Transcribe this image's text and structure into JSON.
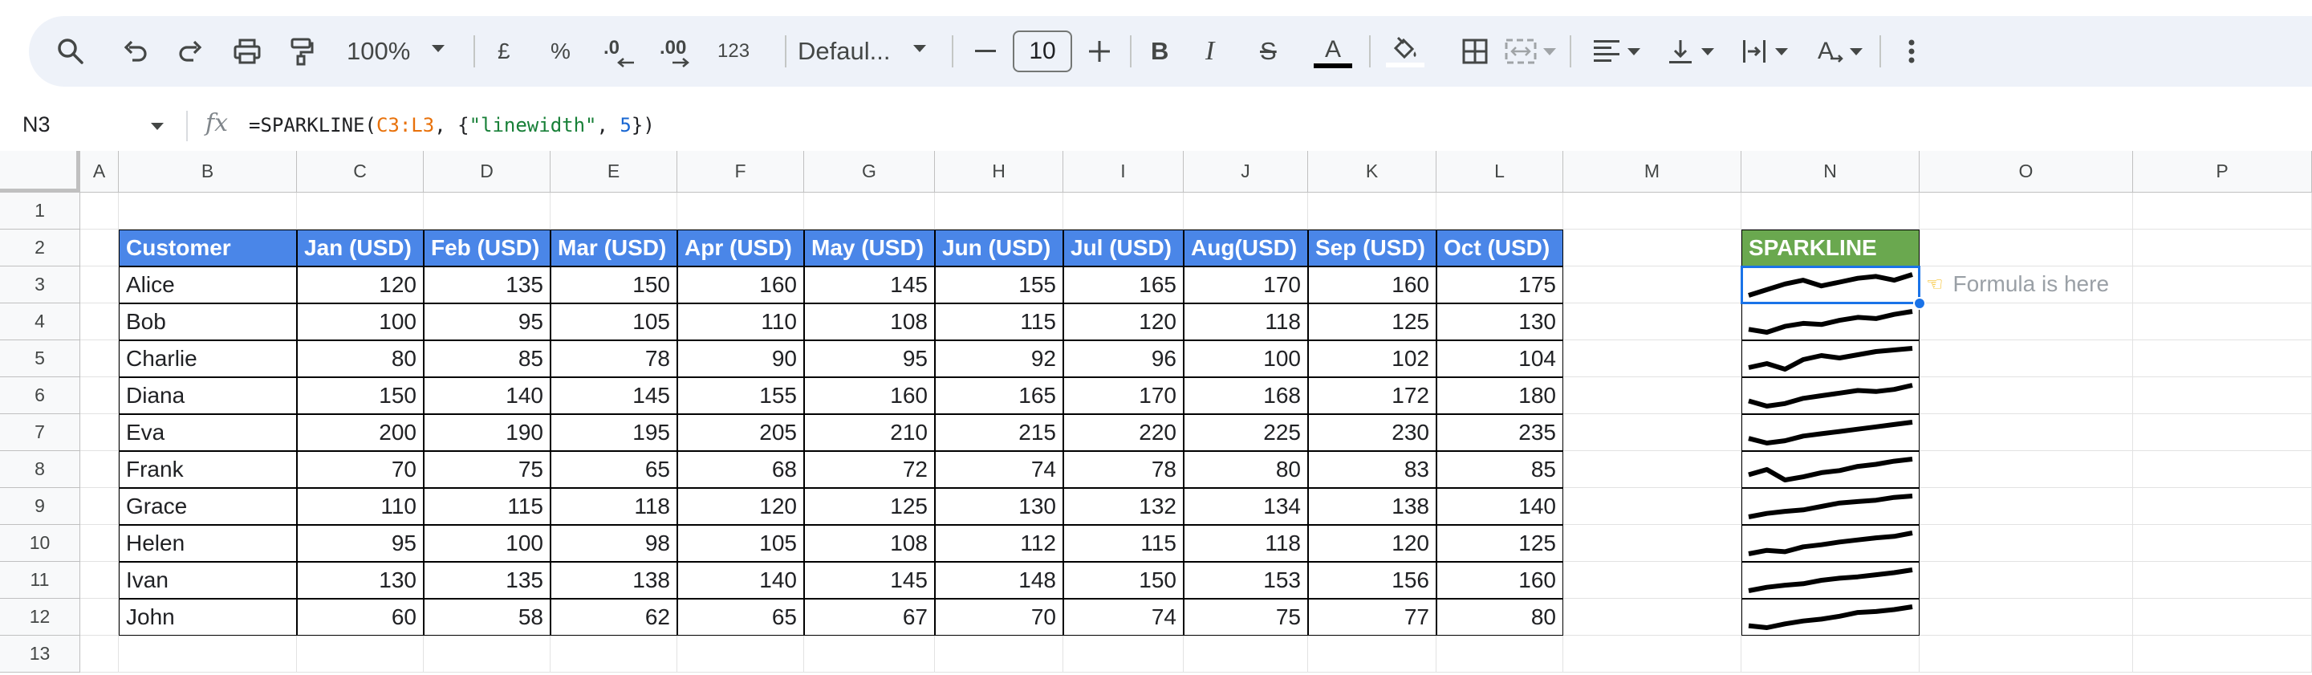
{
  "toolbar": {
    "zoom": "100%",
    "currency": "£",
    "percent": "%",
    "dec_decrease": ".0",
    "dec_increase": ".00",
    "number_format": "123",
    "font": "Defaul...",
    "font_size": "10",
    "bold": "B",
    "italic": "I",
    "strikethrough": "S",
    "text_color": "A",
    "text_rotation": "A"
  },
  "formula_bar": {
    "name_box": "N3",
    "fx": "fx",
    "formula_prefix": "=SPARKLINE(",
    "formula_ref": "C3:L3",
    "formula_mid": ", {",
    "formula_str": "\"linewidth\"",
    "formula_sep": ", ",
    "formula_num": "5",
    "formula_end": "})"
  },
  "columns": [
    "A",
    "B",
    "C",
    "D",
    "E",
    "F",
    "G",
    "H",
    "I",
    "J",
    "K",
    "L",
    "M",
    "N",
    "O",
    "P"
  ],
  "rows": [
    "1",
    "2",
    "3",
    "4",
    "5",
    "6",
    "7",
    "8",
    "9",
    "10",
    "11",
    "12",
    "13"
  ],
  "table": {
    "headers": [
      "Customer",
      "Jan (USD)",
      "Feb (USD)",
      "Mar (USD)",
      "Apr (USD)",
      "May (USD)",
      "Jun (USD)",
      "Jul (USD)",
      "Aug(USD)",
      "Sep (USD)",
      "Oct (USD)"
    ],
    "rows": [
      {
        "name": "Alice",
        "values": [
          120,
          135,
          150,
          160,
          145,
          155,
          165,
          170,
          160,
          175
        ]
      },
      {
        "name": "Bob",
        "values": [
          100,
          95,
          105,
          110,
          108,
          115,
          120,
          118,
          125,
          130
        ]
      },
      {
        "name": "Charlie",
        "values": [
          80,
          85,
          78,
          90,
          95,
          92,
          96,
          100,
          102,
          104
        ]
      },
      {
        "name": "Diana",
        "values": [
          150,
          140,
          145,
          155,
          160,
          165,
          170,
          168,
          172,
          180
        ]
      },
      {
        "name": "Eva",
        "values": [
          200,
          190,
          195,
          205,
          210,
          215,
          220,
          225,
          230,
          235
        ]
      },
      {
        "name": "Frank",
        "values": [
          70,
          75,
          65,
          68,
          72,
          74,
          78,
          80,
          83,
          85
        ]
      },
      {
        "name": "Grace",
        "values": [
          110,
          115,
          118,
          120,
          125,
          130,
          132,
          134,
          138,
          140
        ]
      },
      {
        "name": "Helen",
        "values": [
          95,
          100,
          98,
          105,
          108,
          112,
          115,
          118,
          120,
          125
        ]
      },
      {
        "name": "Ivan",
        "values": [
          130,
          135,
          138,
          140,
          145,
          148,
          150,
          153,
          156,
          160
        ]
      },
      {
        "name": "John",
        "values": [
          60,
          58,
          62,
          65,
          67,
          70,
          74,
          75,
          77,
          80
        ]
      }
    ]
  },
  "sparkline": {
    "header": "SPARKLINE",
    "note": "Formula is here",
    "note_icon": "pointing-hand",
    "header_color": "#6aa84f",
    "table_header_color": "#4a86e8",
    "selection_color": "#1a73e8"
  }
}
